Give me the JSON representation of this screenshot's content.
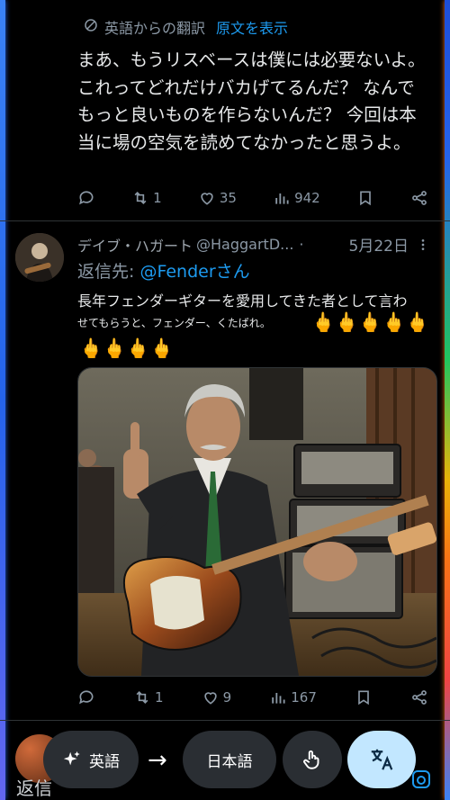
{
  "tweet1": {
    "translated_from": "英語からの翻訳",
    "show_original": "原文を表示",
    "body": "まあ、もうリスベースは僕には必要ないよ。これってどれだけバカげてるんだ？ なんでもっと良いものを作らないんだ？ 今回は本当に場の空気を読めてなかったと思うよ。",
    "retweets": "1",
    "likes": "35",
    "views": "942"
  },
  "tweet2": {
    "author_name": "デイブ・ハガート",
    "author_handle": "@HaggartD...",
    "dot": "·",
    "date": "5月22日",
    "reply_prefix": "返信先:",
    "reply_mention": "@Fenderさん",
    "line1": "長年フェンダーギターを愛用してきた者として言わ",
    "line2": "せてもらうと、フェンダー、くたばれ。",
    "emoji_right": "🖕🖕🖕🖕🖕",
    "emoji_left": "🖕🖕🖕🖕",
    "retweets": "1",
    "likes": "9",
    "views": "167"
  },
  "translate_bar": {
    "source_lang": "英語",
    "arrow": "→",
    "target_lang": "日本語"
  },
  "next_tweet_peek": "返信",
  "colors": {
    "accent": "#1d9bf0",
    "muted": "#8b98a5",
    "fab": "#c2e7ff"
  },
  "icons": [
    "reply-icon",
    "retweet-icon",
    "like-icon",
    "views-icon",
    "bookmark-icon",
    "share-icon",
    "translate-icon",
    "sparkle-icon",
    "touch-gesture-icon",
    "lens-icon"
  ]
}
